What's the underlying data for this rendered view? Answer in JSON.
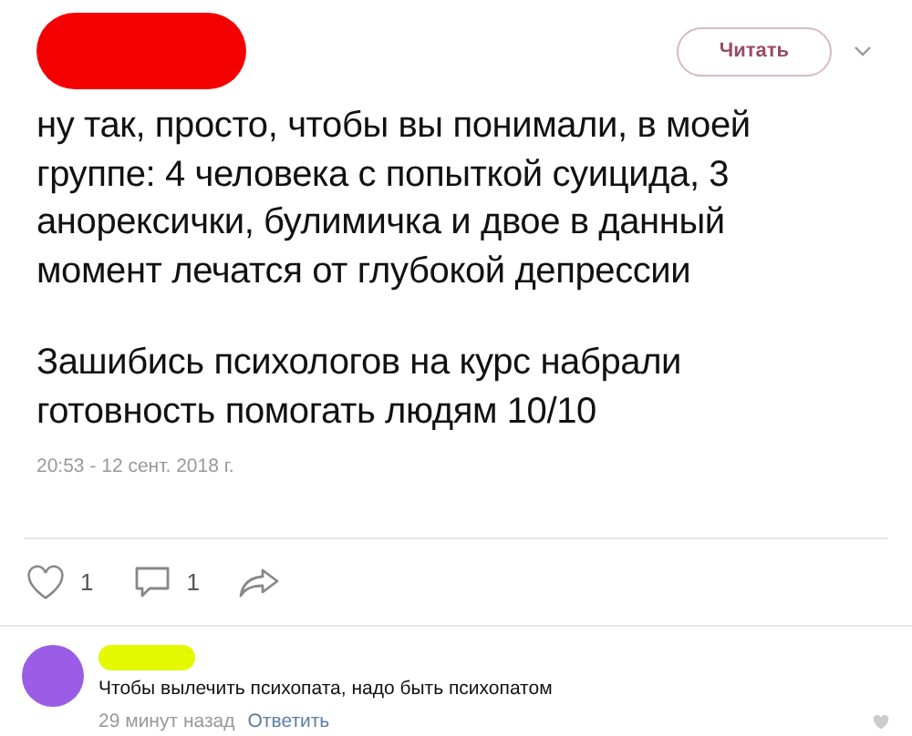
{
  "header": {
    "follow_button": "Читать"
  },
  "post": {
    "paragraphs": [
      [
        "ну так, просто, чтобы вы понимали, в моей",
        "группе: 4 человека с попыткой суицида, 3",
        "анорексички, булимичка и двое в данный",
        "момент лечатся от глубокой депрессии"
      ],
      [
        "Зашибись психологов на курс набрали",
        "готовность помогать людям 10/10"
      ]
    ],
    "timestamp": "20:53 - 12 сент. 2018 г."
  },
  "actions": {
    "likes": "1",
    "comments": "1"
  },
  "comment": {
    "text": "Чтобы вылечить психопата, надо быть психопатом",
    "time": "29 минут назад",
    "reply": "Ответить"
  }
}
